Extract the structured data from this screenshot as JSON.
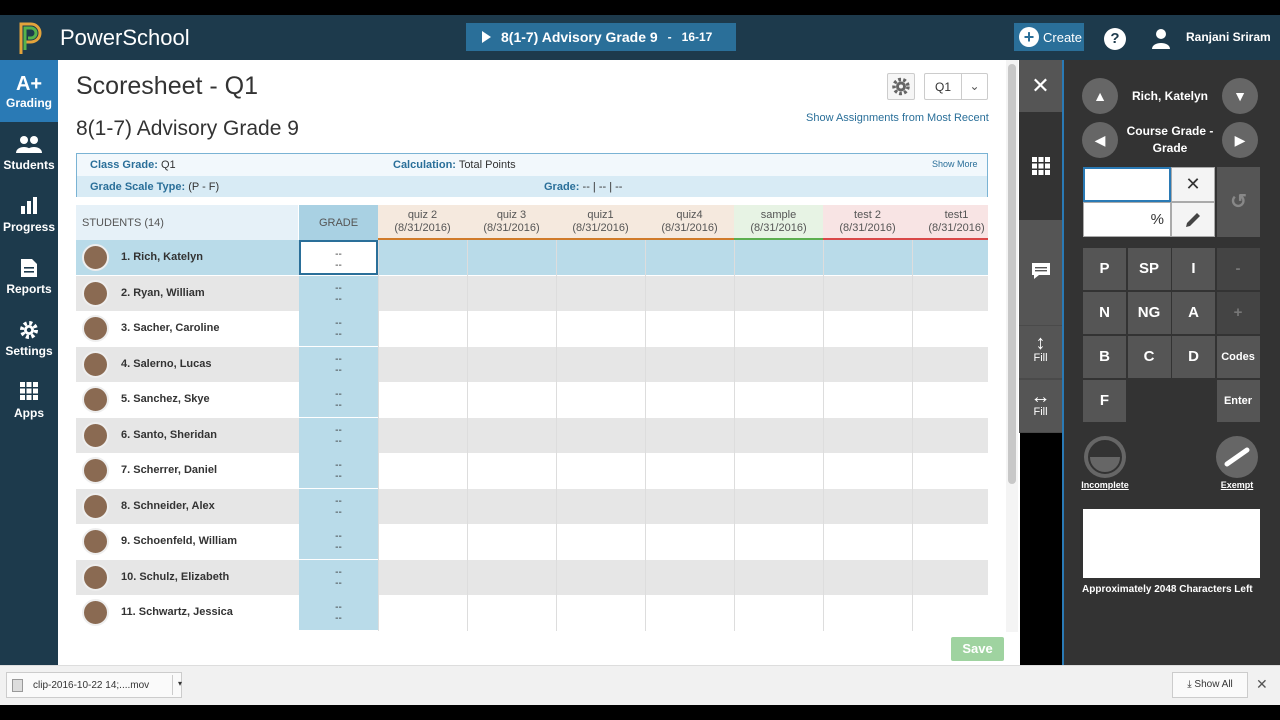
{
  "app": {
    "name": "PowerSchool"
  },
  "header": {
    "course_pill": "8(1-7) Advisory Grade 9",
    "course_year": "16-17",
    "create_label": "Create",
    "help_label": "?",
    "user_name": "Ranjani Sriram"
  },
  "nav": [
    {
      "label": "Grading",
      "icon": "A+"
    },
    {
      "label": "Students",
      "icon": "students-icon"
    },
    {
      "label": "Progress",
      "icon": "bar-chart-icon"
    },
    {
      "label": "Reports",
      "icon": "document-icon"
    },
    {
      "label": "Settings",
      "icon": "gear-icon"
    },
    {
      "label": "Apps",
      "icon": "apps-grid-icon"
    }
  ],
  "page": {
    "title": "Scoresheet - Q1",
    "subtitle": "8(1-7) Advisory Grade 9",
    "term": "Q1",
    "show_assignments": "Show Assignments from Most Recent"
  },
  "info": {
    "class_grade_label": "Class Grade:",
    "class_grade_value": "Q1",
    "calculation_label": "Calculation:",
    "calculation_value": "Total Points",
    "show_more": "Show More",
    "scale_label": "Grade Scale Type:",
    "scale_value": "(P - F)",
    "grade_label": "Grade:",
    "grade_value": "--  |  --  |  --"
  },
  "table": {
    "students_header": "STUDENTS (14)",
    "grade_header": "GRADE",
    "assignments": [
      {
        "name": "quiz 2",
        "date": "(8/31/2016)",
        "color": "#f5e9de",
        "bar": "#d07b2a"
      },
      {
        "name": "quiz 3",
        "date": "(8/31/2016)",
        "color": "#f5e9de",
        "bar": "#d07b2a"
      },
      {
        "name": "quiz1",
        "date": "(8/31/2016)",
        "color": "#f5e9de",
        "bar": "#d07b2a"
      },
      {
        "name": "quiz4",
        "date": "(8/31/2016)",
        "color": "#f5e9de",
        "bar": "#d07b2a"
      },
      {
        "name": "sample",
        "date": "(8/31/2016)",
        "color": "#e7f3e4",
        "bar": "#5cae4f"
      },
      {
        "name": "test 2",
        "date": "(8/31/2016)",
        "color": "#f8e4e4",
        "bar": "#d94848"
      },
      {
        "name": "test1",
        "date": "(8/31/2016)",
        "color": "#f8e4e4",
        "bar": "#d94848"
      }
    ],
    "students": [
      {
        "name": "1.  Rich, Katelyn",
        "grade": "--\n--"
      },
      {
        "name": "2.  Ryan, William",
        "grade": "--\n--"
      },
      {
        "name": "3.  Sacher, Caroline",
        "grade": "--\n--"
      },
      {
        "name": "4.  Salerno, Lucas",
        "grade": "--\n--"
      },
      {
        "name": "5.  Sanchez, Skye",
        "grade": "--\n--"
      },
      {
        "name": "6.  Santo, Sheridan",
        "grade": "--\n--"
      },
      {
        "name": "7.  Scherrer, Daniel",
        "grade": "--\n--"
      },
      {
        "name": "8.  Schneider, Alex",
        "grade": "--\n--"
      },
      {
        "name": "9.  Schoenfeld, William",
        "grade": "--\n--"
      },
      {
        "name": "10.  Schulz, Elizabeth",
        "grade": "--\n--"
      },
      {
        "name": "11.  Schwartz, Jessica",
        "grade": "--\n--"
      }
    ],
    "save_label": "Save"
  },
  "tools": {
    "fill_vertical": "Fill",
    "fill_horizontal": "Fill"
  },
  "panel": {
    "student": "Rich, Katelyn",
    "mode": "Course Grade - Grade",
    "percent_symbol": "%",
    "keys": [
      "P",
      "SP",
      "I",
      "-",
      "N",
      "NG",
      "A",
      "+",
      "B",
      "C",
      "D",
      "Codes",
      "F",
      "Enter"
    ],
    "incomplete_label": "Incomplete",
    "exempt_label": "Exempt",
    "chars_left": "Approximately 2048 Characters Left"
  },
  "downloads": {
    "file": "clip-2016-10-22 14;....mov",
    "show_all": "Show All"
  }
}
